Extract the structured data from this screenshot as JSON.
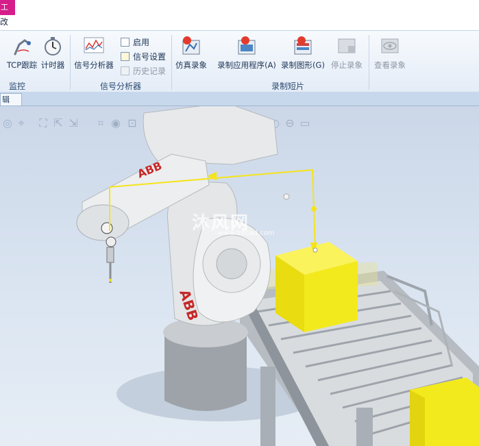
{
  "window": {
    "title_fragment": "工具",
    "menu_fragment": "改"
  },
  "ribbon": {
    "groups": [
      {
        "label": "监控"
      },
      {
        "label": "信号分析器"
      },
      {
        "label": "录制短片"
      }
    ],
    "buttons": {
      "tcp_trace": "TCP跟踪",
      "timer": "计时器",
      "signal_analyzer": "信号分析器",
      "enable": "启用",
      "signal_setup": "信号设置",
      "history": "历史记录",
      "record_sim": "仿真录象",
      "record_app": "录制应用程序(A)",
      "record_graphics": "录制图形(G)",
      "stop_record": "停止录象",
      "view_record": "查看录象"
    }
  },
  "doc_tab": {
    "label": "辑"
  },
  "viewport": {
    "robot_brand": "ABB",
    "watermark": "沐风网",
    "watermark_url": "www.mfcad.com"
  },
  "colors": {
    "accent": "#d61e8a",
    "robot_body": "#e4e6e8",
    "brand_red": "#c62828",
    "box_yellow": "#f3ea1e",
    "path_yellow": "#f5e41a"
  }
}
